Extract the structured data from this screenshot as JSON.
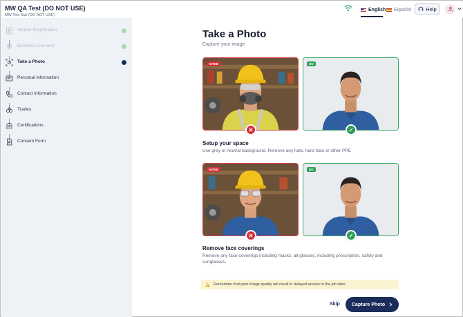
{
  "header": {
    "org_title": "MW QA Test (DO NOT USE)",
    "org_sub": "MW Test Sub (DO NOT USE)",
    "languages": [
      {
        "label": "English",
        "active": true
      },
      {
        "label": "Español",
        "active": false
      }
    ],
    "help_label": "Help"
  },
  "sidebar": {
    "steps": [
      {
        "label": "Worker Registration",
        "state": "done",
        "icon": "user-id-icon"
      },
      {
        "label": "Biometric Consent",
        "state": "done",
        "icon": "fingerprint-icon"
      },
      {
        "label": "Take a Photo",
        "state": "active",
        "icon": "camera-icon"
      },
      {
        "label": "Personal Information",
        "state": "todo",
        "icon": "id-card-icon"
      },
      {
        "label": "Contact Information",
        "state": "todo",
        "icon": "phone-icon"
      },
      {
        "label": "Trades",
        "state": "todo",
        "icon": "tools-icon"
      },
      {
        "label": "Certifications",
        "state": "todo",
        "icon": "certificate-icon"
      },
      {
        "label": "Consent Form",
        "state": "todo",
        "icon": "document-icon"
      }
    ]
  },
  "main": {
    "title": "Take a Photo",
    "subtitle": "Capture your image",
    "sections": [
      {
        "title": "Setup your space",
        "description": "Use grey or neutral background. Remove any hats, hard hats or other PPE",
        "avoid_tag": "AVOID",
        "do_tag": "DO"
      },
      {
        "title": "Remove face coverings",
        "description": "Remove any face coverings including masks, all glasses, including prescription, safety and sunglasses.",
        "avoid_tag": "AVOID",
        "do_tag": "DO"
      }
    ],
    "warning": "Remember that poor image quality will result in delayed access to the job sites",
    "skip_label": "Skip",
    "capture_label": "Capture Photo"
  },
  "colors": {
    "primary": "#1b2c5c",
    "avoid": "#d62f3b",
    "do": "#2e9e58",
    "sidebar_bg": "#eef2f7",
    "warning_bg": "#fbf3cf"
  }
}
